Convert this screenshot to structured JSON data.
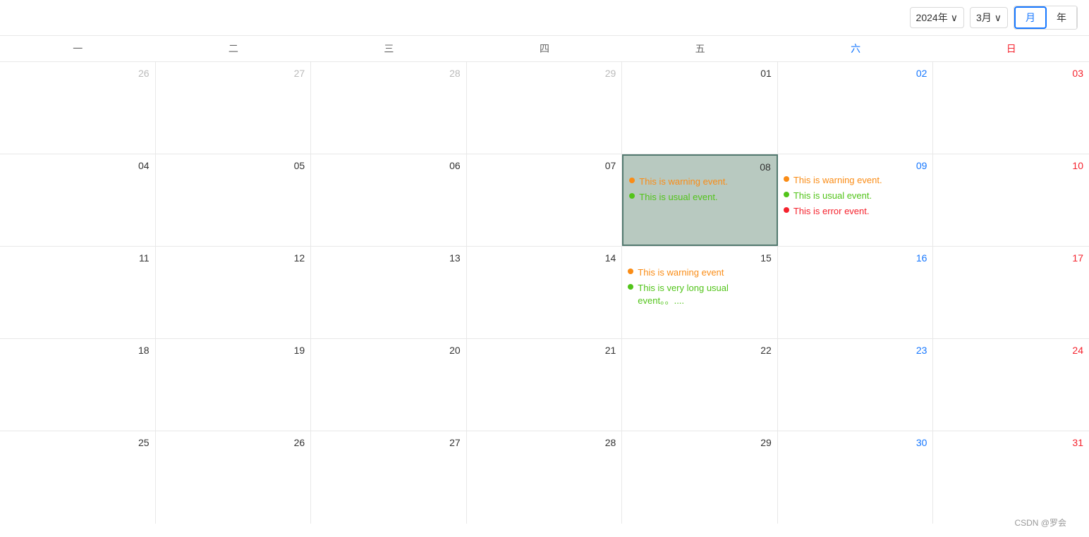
{
  "header": {
    "year": "2024年",
    "month": "3月",
    "view_month": "月",
    "view_year": "年",
    "chevron": "∨"
  },
  "weekdays": [
    {
      "label": "一",
      "type": "normal"
    },
    {
      "label": "二",
      "type": "normal"
    },
    {
      "label": "三",
      "type": "normal"
    },
    {
      "label": "四",
      "type": "normal"
    },
    {
      "label": "五",
      "type": "normal"
    },
    {
      "label": "六",
      "type": "saturday"
    },
    {
      "label": "日",
      "type": "sunday"
    }
  ],
  "weeks": [
    {
      "days": [
        {
          "number": "26",
          "type": "other-month",
          "numberClass": "",
          "events": []
        },
        {
          "number": "27",
          "type": "other-month",
          "numberClass": "",
          "events": []
        },
        {
          "number": "28",
          "type": "other-month",
          "numberClass": "",
          "events": []
        },
        {
          "number": "29",
          "type": "other-month",
          "numberClass": "",
          "events": []
        },
        {
          "number": "01",
          "type": "current",
          "numberClass": "",
          "events": []
        },
        {
          "number": "02",
          "type": "current",
          "numberClass": "blue",
          "events": []
        },
        {
          "number": "03",
          "type": "current",
          "numberClass": "red",
          "events": []
        }
      ]
    },
    {
      "days": [
        {
          "number": "04",
          "type": "current",
          "numberClass": "",
          "events": []
        },
        {
          "number": "05",
          "type": "current",
          "numberClass": "",
          "events": []
        },
        {
          "number": "06",
          "type": "current",
          "numberClass": "",
          "events": []
        },
        {
          "number": "07",
          "type": "current",
          "numberClass": "",
          "events": []
        },
        {
          "number": "08",
          "type": "today",
          "numberClass": "",
          "events": [
            {
              "dot": "warning",
              "text": "This is warning event."
            },
            {
              "dot": "usual",
              "text": "This is usual event."
            }
          ]
        },
        {
          "number": "09",
          "type": "current",
          "numberClass": "blue",
          "events": [
            {
              "dot": "warning",
              "text": "This is warning event."
            },
            {
              "dot": "usual",
              "text": "This is usual event."
            },
            {
              "dot": "error",
              "text": "This is error event."
            }
          ]
        },
        {
          "number": "10",
          "type": "current",
          "numberClass": "red",
          "events": []
        }
      ]
    },
    {
      "days": [
        {
          "number": "11",
          "type": "current",
          "numberClass": "",
          "events": []
        },
        {
          "number": "12",
          "type": "current",
          "numberClass": "",
          "events": []
        },
        {
          "number": "13",
          "type": "current",
          "numberClass": "",
          "events": []
        },
        {
          "number": "14",
          "type": "current",
          "numberClass": "",
          "events": []
        },
        {
          "number": "15",
          "type": "current",
          "numberClass": "",
          "scrollable": true,
          "events": [
            {
              "dot": "warning",
              "text": "This is warning event"
            },
            {
              "dot": "usual",
              "text": "This is very long usual event。。...."
            }
          ]
        },
        {
          "number": "16",
          "type": "current",
          "numberClass": "blue",
          "events": []
        },
        {
          "number": "17",
          "type": "current",
          "numberClass": "red",
          "events": []
        }
      ]
    },
    {
      "days": [
        {
          "number": "18",
          "type": "current",
          "numberClass": "",
          "events": []
        },
        {
          "number": "19",
          "type": "current",
          "numberClass": "",
          "events": []
        },
        {
          "number": "20",
          "type": "current",
          "numberClass": "",
          "events": []
        },
        {
          "number": "21",
          "type": "current",
          "numberClass": "",
          "events": []
        },
        {
          "number": "22",
          "type": "current",
          "numberClass": "",
          "events": []
        },
        {
          "number": "23",
          "type": "current",
          "numberClass": "blue",
          "events": []
        },
        {
          "number": "24",
          "type": "current",
          "numberClass": "red",
          "events": []
        }
      ]
    },
    {
      "days": [
        {
          "number": "25",
          "type": "current",
          "numberClass": "",
          "events": []
        },
        {
          "number": "26",
          "type": "current",
          "numberClass": "",
          "events": []
        },
        {
          "number": "27",
          "type": "current",
          "numberClass": "",
          "events": []
        },
        {
          "number": "28",
          "type": "current",
          "numberClass": "",
          "events": []
        },
        {
          "number": "29",
          "type": "current",
          "numberClass": "",
          "events": []
        },
        {
          "number": "30",
          "type": "current",
          "numberClass": "blue",
          "events": []
        },
        {
          "number": "31",
          "type": "current",
          "numberClass": "red",
          "events": []
        }
      ]
    }
  ],
  "footer": {
    "credit": "CSDN @罗会"
  },
  "dot_colors": {
    "warning": "#fa8c16",
    "usual": "#52c41a",
    "error": "#f5222d"
  }
}
